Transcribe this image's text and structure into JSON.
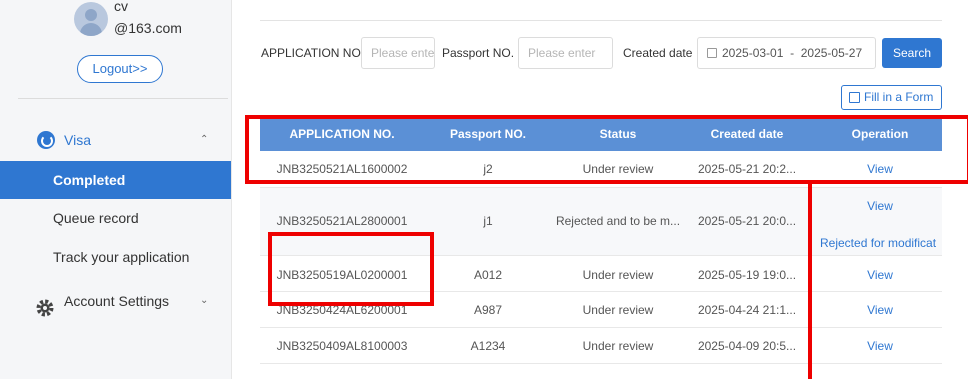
{
  "user": {
    "name": "cv",
    "email": "@163.com",
    "logout_label": "Logout>>"
  },
  "sidebar": {
    "visa_label": "Visa",
    "visa_items": [
      "Completed",
      "Queue record",
      "Track your application"
    ],
    "account_label": "Account Settings"
  },
  "filters": {
    "app_no_label": "APPLICATION NO.",
    "app_no_placeholder": "Please ente",
    "passport_label": "Passport NO.",
    "passport_placeholder": "Please enter",
    "created_label": "Created date",
    "date_start": "2025-03-01",
    "date_sep": "-",
    "date_end": "2025-05-27",
    "search_label": "Search",
    "fill_form_label": "Fill in a Form"
  },
  "table": {
    "headers": [
      "APPLICATION NO.",
      "Passport NO.",
      "Status",
      "Created date",
      "Operation"
    ],
    "rows": [
      {
        "app_no": "JNB3250521AL1600002",
        "passport": "j2",
        "status": "Under review",
        "created": "2025-05-21 20:2...",
        "ops": [
          "View"
        ]
      },
      {
        "app_no": "JNB3250521AL2800001",
        "passport": "j1",
        "status": "Rejected and to be m...",
        "created": "2025-05-21 20:0...",
        "ops": [
          "View",
          "Rejected for modificat"
        ]
      },
      {
        "app_no": "JNB3250519AL0200001",
        "passport": "A012",
        "status": "Under review",
        "created": "2025-05-19 19:0...",
        "ops": [
          "View"
        ]
      },
      {
        "app_no": "JNB3250424AL6200001",
        "passport": "A987",
        "status": "Under review",
        "created": "2025-04-24 21:1...",
        "ops": [
          "View"
        ]
      },
      {
        "app_no": "JNB3250409AL8100003",
        "passport": "A1234",
        "status": "Under review",
        "created": "2025-04-09 20:5...",
        "ops": [
          "View"
        ]
      }
    ]
  },
  "colors": {
    "accent": "#2f77d1",
    "header_bg": "#5b90d6",
    "annotation": "#ee0000"
  }
}
